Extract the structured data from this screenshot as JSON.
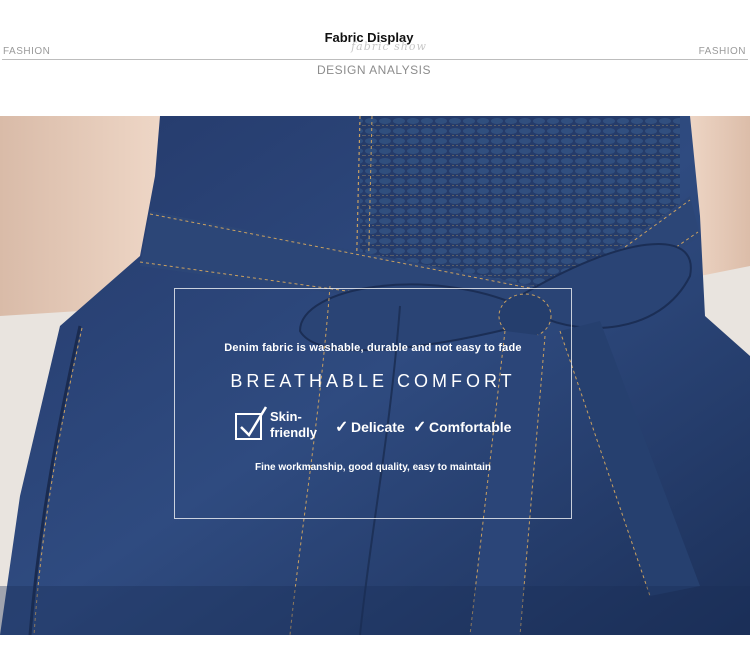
{
  "header": {
    "left_label": "FASHION",
    "right_label": "FASHION",
    "title": "Fabric Display",
    "script_text": "fabric show",
    "subtitle": "DESIGN ANALYSIS"
  },
  "overlay": {
    "line1": "Denim fabric is washable, durable and not easy to fade",
    "line2": "BREATHABLE  COMFORT",
    "features": {
      "feature1_line1": "Skin-",
      "feature1_line2": "friendly",
      "check_mark": "✓",
      "feature2": "Delicate",
      "feature3": "Comfortable"
    },
    "line3": "Fine workmanship, good quality, easy to maintain"
  },
  "colors": {
    "denim_dark": "#1f3560",
    "denim_mid": "#2e4a7e",
    "denim_light": "#3b5a92",
    "skin": "#e8cdbb",
    "stitch": "#c9a061"
  }
}
